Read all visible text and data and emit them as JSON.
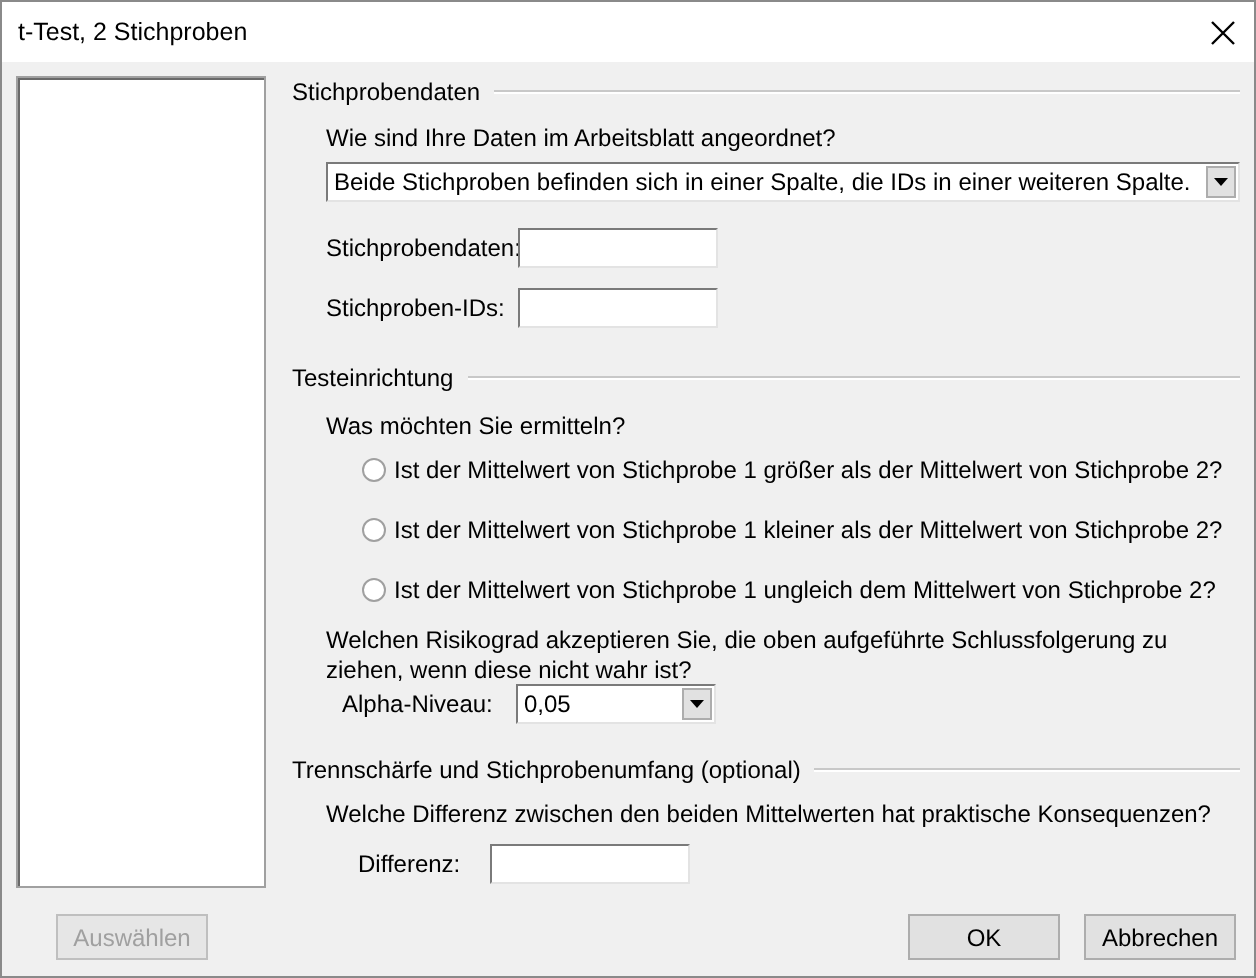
{
  "window": {
    "title": "t-Test, 2 Stichproben"
  },
  "sections": [
    {
      "title": "Stichprobendaten",
      "items": [
        {
          "kind": "question",
          "text": "Wie sind Ihre Daten im Arbeitsblatt angeordnet?"
        },
        {
          "kind": "combo",
          "value": "Beide Stichproben befinden sich in einer Spalte, die IDs in einer weiteren Spalte."
        },
        {
          "kind": "field",
          "label": "Stichprobendaten:"
        },
        {
          "kind": "field",
          "label": "Stichproben-IDs:"
        }
      ]
    },
    {
      "title": "Testeinrichtung",
      "items": [
        {
          "kind": "question",
          "text": "Was möchten Sie ermitteln?"
        },
        {
          "kind": "radio",
          "label": "Ist der Mittelwert von Stichprobe 1 größer als der Mittelwert von Stichprobe 2?",
          "selected": false
        },
        {
          "kind": "radio",
          "label": "Ist der Mittelwert von Stichprobe 1 kleiner als der Mittelwert von Stichprobe 2?",
          "selected": false
        },
        {
          "kind": "radio",
          "label": "Ist der Mittelwert von Stichprobe 1 ungleich dem Mittelwert von Stichprobe 2?",
          "selected": false
        },
        {
          "kind": "question",
          "text": "Welchen Risikograd akzeptieren Sie, die oben aufgeführte Schlussfolgerung zu ziehen, wenn diese nicht wahr ist?"
        },
        {
          "kind": "combo-field",
          "label": "Alpha-Niveau:",
          "value": "0,05"
        }
      ]
    },
    {
      "title": "Trennschärfe und Stichprobenumfang (optional)",
      "items": [
        {
          "kind": "question",
          "text": "Welche Differenz zwischen den beiden Mittelwerten hat praktische Konsequenzen?"
        },
        {
          "kind": "field",
          "label": "Differenz:"
        }
      ]
    }
  ],
  "buttons": [
    {
      "label": "Auswählen",
      "disabled": true
    },
    {
      "label": "OK",
      "disabled": false
    },
    {
      "label": "Abbrechen",
      "disabled": false
    }
  ]
}
